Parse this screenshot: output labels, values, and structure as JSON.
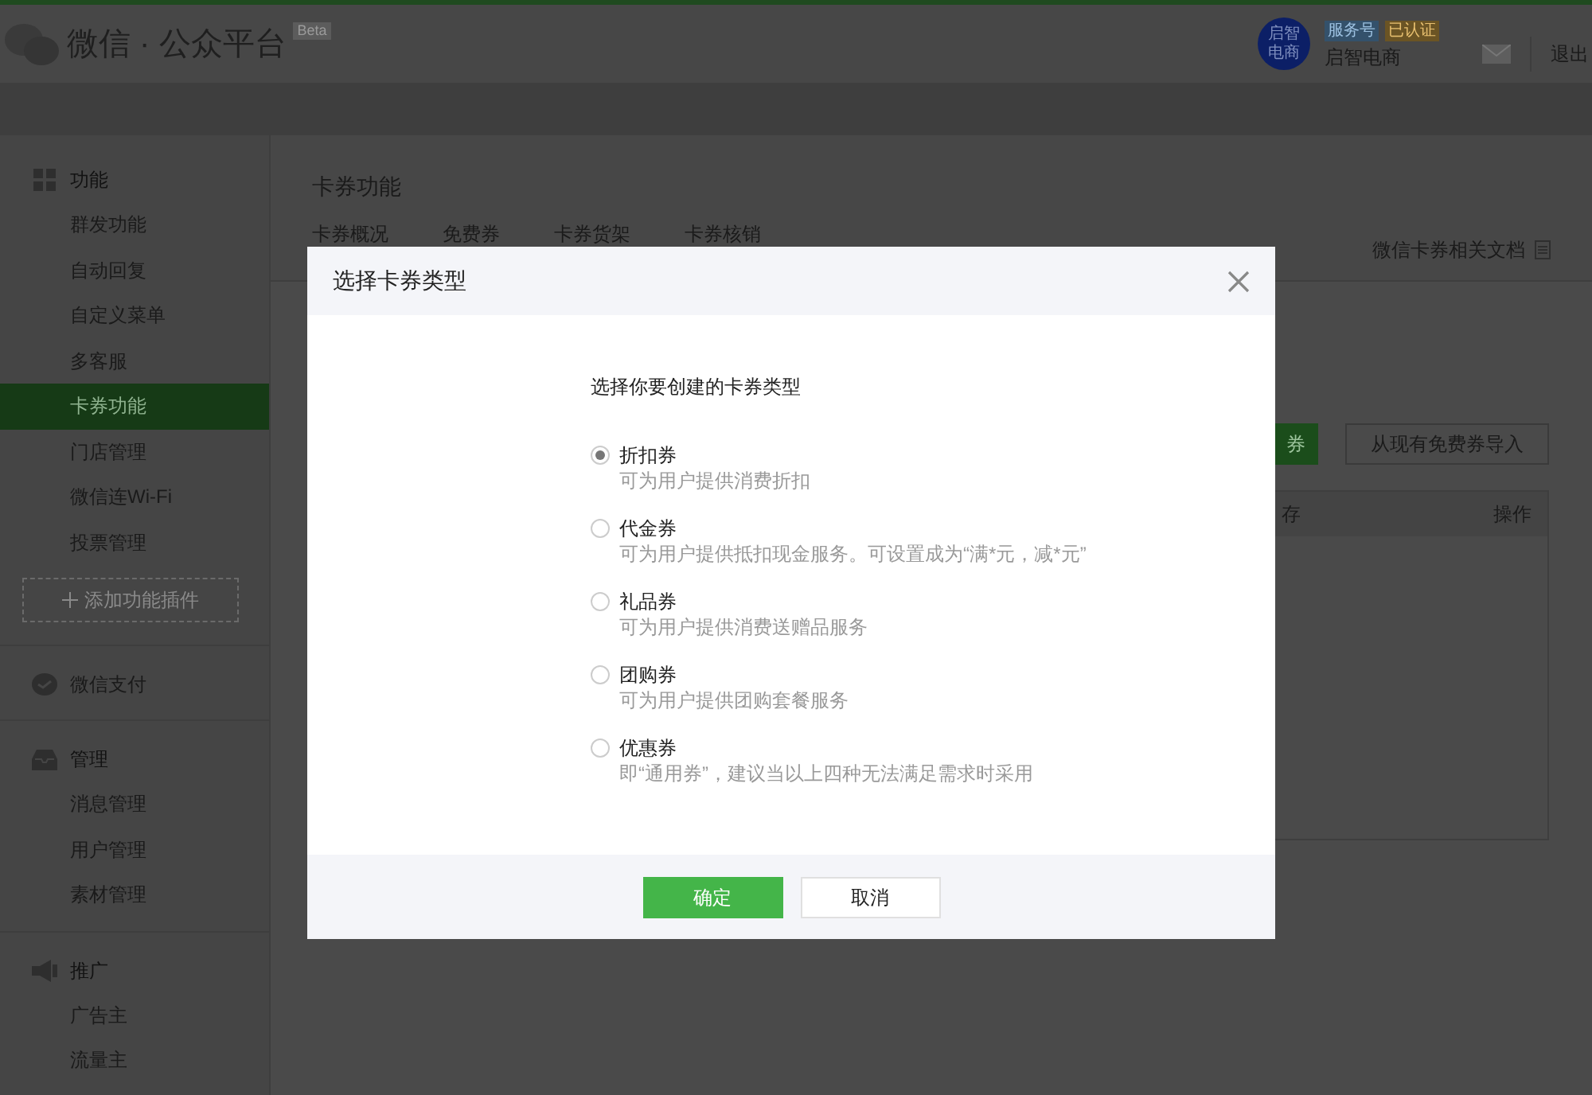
{
  "header": {
    "brand": "微信 · 公众平台",
    "beta": "Beta",
    "account": {
      "avatar_text": "启智电商",
      "badges": [
        {
          "label": "服务号",
          "color": "#34516b"
        },
        {
          "label": "已认证",
          "color": "#6b5424"
        }
      ],
      "name": "启智电商"
    },
    "logout": "退出"
  },
  "sidebar": {
    "sections": [
      {
        "title": "功能",
        "items": [
          {
            "label": "群发功能",
            "selected": false
          },
          {
            "label": "自动回复",
            "selected": false
          },
          {
            "label": "自定义菜单",
            "selected": false
          },
          {
            "label": "多客服",
            "selected": false
          },
          {
            "label": "卡券功能",
            "selected": true
          },
          {
            "label": "门店管理",
            "selected": false
          },
          {
            "label": "微信连Wi-Fi",
            "selected": false
          },
          {
            "label": "投票管理",
            "selected": false
          }
        ],
        "add_button": "添加功能插件"
      },
      {
        "title": "微信支付"
      },
      {
        "title": "管理",
        "items": [
          {
            "label": "消息管理",
            "selected": false
          },
          {
            "label": "用户管理",
            "selected": false
          },
          {
            "label": "素材管理",
            "selected": false
          }
        ]
      },
      {
        "title": "推广",
        "items": [
          {
            "label": "广告主",
            "selected": false
          },
          {
            "label": "流量主",
            "selected": false
          }
        ]
      }
    ]
  },
  "content": {
    "title": "卡券功能",
    "tabs": [
      {
        "label": "卡券概况",
        "selected": false
      },
      {
        "label": "免费券",
        "selected": false
      },
      {
        "label": "卡券货架",
        "selected": false
      },
      {
        "label": "卡券核销",
        "selected": false
      }
    ],
    "doc_link": "微信卡券相关文档",
    "create_button": "券",
    "import_button": "从现有免费券导入",
    "table": {
      "columns": [
        "存",
        "操作"
      ]
    }
  },
  "dialog": {
    "title": "选择卡券类型",
    "prompt": "选择你要创建的卡券类型",
    "options": [
      {
        "label": "折扣券",
        "description": "可为用户提供消费折扣",
        "selected": true
      },
      {
        "label": "代金券",
        "description": "可为用户提供抵扣现金服务。可设置成为“满*元，减*元”",
        "selected": false
      },
      {
        "label": "礼品券",
        "description": "可为用户提供消费送赠品服务",
        "selected": false
      },
      {
        "label": "团购券",
        "description": "可为用户提供团购套餐服务",
        "selected": false
      },
      {
        "label": "优惠券",
        "description": "即“通用券”，建议当以上四种无法满足需求时采用",
        "selected": false
      }
    ],
    "buttons": [
      {
        "label": "确定",
        "kind": "primary"
      },
      {
        "label": "取消",
        "kind": "default"
      }
    ]
  }
}
